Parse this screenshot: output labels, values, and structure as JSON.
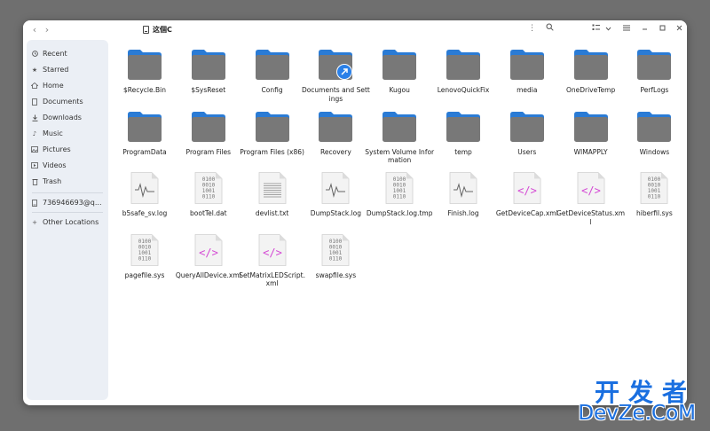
{
  "path": {
    "label": "这個C"
  },
  "sidebar": {
    "items": [
      {
        "label": "Recent",
        "icon": "clock-icon"
      },
      {
        "label": "Starred",
        "icon": "star-icon"
      },
      {
        "label": "Home",
        "icon": "home-icon"
      },
      {
        "label": "Documents",
        "icon": "document-icon"
      },
      {
        "label": "Downloads",
        "icon": "download-icon"
      },
      {
        "label": "Music",
        "icon": "music-icon"
      },
      {
        "label": "Pictures",
        "icon": "picture-icon"
      },
      {
        "label": "Videos",
        "icon": "video-icon"
      },
      {
        "label": "Trash",
        "icon": "trash-icon"
      }
    ],
    "drive": {
      "label": "736946693@q...",
      "icon": "drive-icon"
    },
    "other": {
      "label": "Other Locations",
      "icon": "plus-icon"
    }
  },
  "files": [
    {
      "name": "$Recycle.Bin",
      "type": "folder"
    },
    {
      "name": "$SysReset",
      "type": "folder"
    },
    {
      "name": "Config",
      "type": "folder"
    },
    {
      "name": "Documents and Settings",
      "type": "folder-link"
    },
    {
      "name": "Kugou",
      "type": "folder"
    },
    {
      "name": "LenovoQuickFix",
      "type": "folder"
    },
    {
      "name": "media",
      "type": "folder"
    },
    {
      "name": "OneDriveTemp",
      "type": "folder"
    },
    {
      "name": "PerfLogs",
      "type": "folder"
    },
    {
      "name": "ProgramData",
      "type": "folder"
    },
    {
      "name": "Program Files",
      "type": "folder"
    },
    {
      "name": "Program Files (x86)",
      "type": "folder"
    },
    {
      "name": "Recovery",
      "type": "folder"
    },
    {
      "name": "System Volume Information",
      "type": "folder"
    },
    {
      "name": "temp",
      "type": "folder"
    },
    {
      "name": "Users",
      "type": "folder"
    },
    {
      "name": "WIMAPPLY",
      "type": "folder"
    },
    {
      "name": "Windows",
      "type": "folder"
    },
    {
      "name": "b5safe_sv.log",
      "type": "log"
    },
    {
      "name": "bootTel.dat",
      "type": "binary"
    },
    {
      "name": "devlist.txt",
      "type": "text"
    },
    {
      "name": "DumpStack.log",
      "type": "log"
    },
    {
      "name": "DumpStack.log.tmp",
      "type": "binary"
    },
    {
      "name": "Finish.log",
      "type": "log"
    },
    {
      "name": "GetDeviceCap.xml",
      "type": "xml"
    },
    {
      "name": "GetDeviceStatus.xml",
      "type": "xml"
    },
    {
      "name": "hiberfil.sys",
      "type": "binary"
    },
    {
      "name": "pagefile.sys",
      "type": "binary"
    },
    {
      "name": "QueryAllDevice.xml",
      "type": "xml"
    },
    {
      "name": "SetMatrixLEDScript.xml",
      "type": "xml"
    },
    {
      "name": "swapfile.sys",
      "type": "binary"
    }
  ],
  "binary_lines": [
    "0100",
    "0010",
    "1001",
    "0110"
  ],
  "colors": {
    "folder_body": "#787878",
    "folder_tab": "#2a7bd5",
    "accent": "#2a80e8",
    "xml_tag": "#d448d4"
  },
  "watermark": {
    "cn": "开发者",
    "en": "DevZe.CoM"
  }
}
